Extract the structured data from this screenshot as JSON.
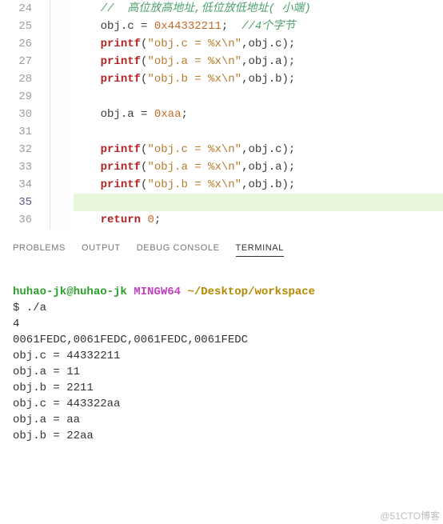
{
  "editor": {
    "lines": [
      {
        "n": "24",
        "type": "comment",
        "text": "//  高位放高地址,低位放低地址( 小端)"
      },
      {
        "n": "25",
        "type": "assign_int_comment",
        "obj": "obj",
        "prop": "c",
        "value": "0x44332211",
        "comment": "//4个字节"
      },
      {
        "n": "26",
        "type": "printf",
        "fmt": "\"obj.c = %x\\n\"",
        "arg_obj": "obj",
        "arg_prop": "c"
      },
      {
        "n": "27",
        "type": "printf",
        "fmt": "\"obj.a = %x\\n\"",
        "arg_obj": "obj",
        "arg_prop": "a"
      },
      {
        "n": "28",
        "type": "printf",
        "fmt": "\"obj.b = %x\\n\"",
        "arg_obj": "obj",
        "arg_prop": "b"
      },
      {
        "n": "29",
        "type": "blank"
      },
      {
        "n": "30",
        "type": "assign_int",
        "obj": "obj",
        "prop": "a",
        "value": "0xaa"
      },
      {
        "n": "31",
        "type": "blank"
      },
      {
        "n": "32",
        "type": "printf",
        "fmt": "\"obj.c = %x\\n\"",
        "arg_obj": "obj",
        "arg_prop": "c"
      },
      {
        "n": "33",
        "type": "printf",
        "fmt": "\"obj.a = %x\\n\"",
        "arg_obj": "obj",
        "arg_prop": "a"
      },
      {
        "n": "34",
        "type": "printf",
        "fmt": "\"obj.b = %x\\n\"",
        "arg_obj": "obj",
        "arg_prop": "b"
      },
      {
        "n": "35",
        "type": "blank",
        "active": true
      },
      {
        "n": "36",
        "type": "return",
        "value": "0"
      }
    ]
  },
  "panel": {
    "tabs": {
      "problems": "PROBLEMS",
      "output": "OUTPUT",
      "debug": "DEBUG CONSOLE",
      "terminal": "TERMINAL"
    },
    "active_tab": "terminal"
  },
  "terminal": {
    "user": "huhao-jk@huhao-jk",
    "sys": "MINGW64",
    "path": "~/Desktop/workspace",
    "cmd_prefix": "$ ",
    "cmd": "./a",
    "output": [
      "4",
      "0061FEDC,0061FEDC,0061FEDC,0061FEDC",
      "obj.c = 44332211",
      "obj.a = 11",
      "obj.b = 2211",
      "obj.c = 443322aa",
      "obj.a = aa",
      "obj.b = 22aa"
    ]
  },
  "watermark": "@51CTO博客"
}
